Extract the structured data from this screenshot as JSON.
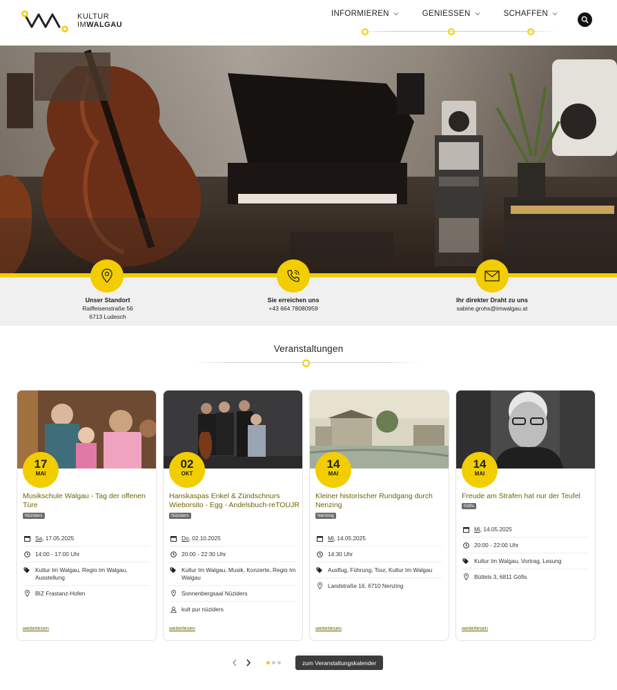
{
  "header": {
    "logo_line1": "KULTUR",
    "logo_line2_a": "IM",
    "logo_line2_b": "WALGAU",
    "nav": [
      {
        "label": "INFORMIEREN"
      },
      {
        "label": "GENIESSEN"
      },
      {
        "label": "SCHAFFEN"
      }
    ]
  },
  "contact": [
    {
      "title": "Unser Standort",
      "line1": "Raiffeisenstraße 56",
      "line2": "6713 Ludesch",
      "icon": "location-pin-icon"
    },
    {
      "title": "Sie erreichen uns",
      "line1": "+43 664 78080959",
      "line2": "",
      "icon": "phone-icon"
    },
    {
      "title": "Ihr direkter Draht zu uns",
      "line1": "sabine.grohs@imwalgau.at",
      "line2": "",
      "icon": "mail-icon"
    }
  ],
  "section": {
    "title": "Veranstaltungen"
  },
  "cards": [
    {
      "day": "17",
      "month": "MAI",
      "title": "Musikschule Walgau - Tag der offenen Türe",
      "tag": "Nüziders",
      "date_day": "Sa",
      "date_rest": ", 17.05.2025",
      "time": "14:00 - 17:00 Uhr",
      "categories": "Kultur Im Walgau, Regio Im Walgau, Ausstellung",
      "location": "BIZ Frastanz-Hofen",
      "organizer": "",
      "more": "weiterlesen"
    },
    {
      "day": "02",
      "month": "OKT",
      "title": "Hanskaspas Enkel & Zündschnurs Wieborsito - Egg - Andelsbuch-reTOUJR",
      "tag": "Nüziders",
      "date_day": "Do",
      "date_rest": ", 02.10.2025",
      "time": "20:00 - 22:30 Uhr",
      "categories": "Kultur Im Walgau, Musik, Konzerte, Regio Im Walgau",
      "location": "Sonnenbergsaal Nüziders",
      "organizer": "kult pur nüziders",
      "more": "weiterlesen"
    },
    {
      "day": "14",
      "month": "MAI",
      "title": "Kleiner historischer Rundgang durch Nenzing",
      "tag": "Nenzing",
      "date_day": "Mi",
      "date_rest": ", 14.05.2025",
      "time": "14:30 Uhr",
      "categories": "Ausflug, Führung, Tour, Kultur Im Walgau",
      "location": "Landstraße 16, 6710 Nenzing",
      "organizer": "",
      "more": "weiterlesen"
    },
    {
      "day": "14",
      "month": "MAI",
      "title": "Freude am Strafen hat nur der Teufel",
      "tag": "Göfis",
      "date_day": "Mi",
      "date_rest": ", 14.05.2025",
      "time": "20:00 - 22:00 Uhr",
      "categories": "Kultur Im Walgau, Vortrag, Lesung",
      "location": "Büttels 3, 6811 Göfis",
      "organizer": "",
      "more": "weiterlesen"
    }
  ],
  "pager": {
    "button_label": "zum Veranstaltungskalender",
    "pages": 3,
    "active": 1
  },
  "colors": {
    "accent": "#f2cd00",
    "title_olive": "#6e6400",
    "dark": "#3d3d3d"
  }
}
